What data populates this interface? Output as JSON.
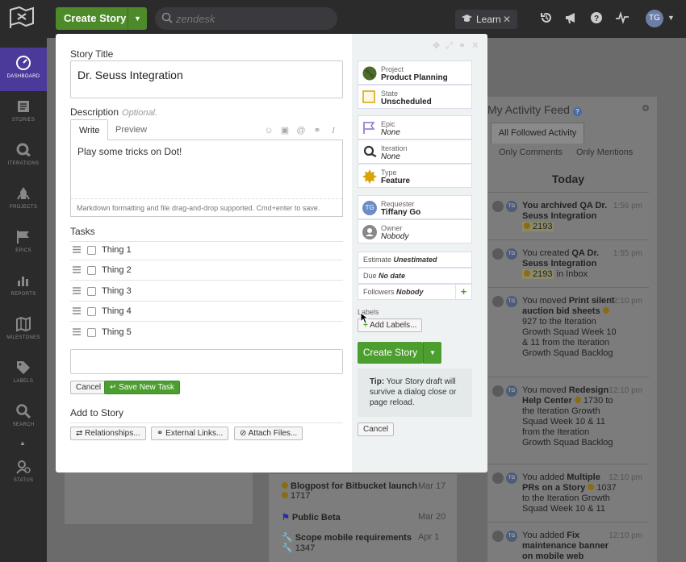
{
  "topbar": {
    "create_story": "Create Story",
    "search_placeholder": "zendesk",
    "learn": "Learn",
    "avatar": "TG"
  },
  "sidenav": [
    {
      "label": "DASHBOARD",
      "icon": "dashboard-icon",
      "active": true
    },
    {
      "label": "STORIES",
      "icon": "stories-icon"
    },
    {
      "label": "ITERATIONS",
      "icon": "iterations-icon"
    },
    {
      "label": "PROJECTS",
      "icon": "projects-icon"
    },
    {
      "label": "EPICS",
      "icon": "epics-icon"
    },
    {
      "label": "REPORTS",
      "icon": "reports-icon"
    },
    {
      "label": "MILESTONES",
      "icon": "milestones-icon"
    },
    {
      "label": "LABELS",
      "icon": "labels-icon"
    },
    {
      "label": "SEARCH",
      "icon": "search-icon"
    },
    {
      "label": "STATUS",
      "icon": "status-icon"
    }
  ],
  "feed": {
    "title": "My Activity Feed",
    "tab_all": "All Followed Activity",
    "tab_comments": "Only Comments",
    "tab_mentions": "Only Mentions",
    "today": "Today",
    "items": [
      {
        "avatar": "TG",
        "time": "1:56 pm",
        "pre": "You archived ",
        "bold": "QA Dr. Seuss Integration",
        "id": "2193",
        "post": ""
      },
      {
        "avatar": "TG",
        "time": "1:55 pm",
        "pre": "You created ",
        "bold": "QA Dr. Seuss Integration",
        "id": "2193",
        "post": " in Inbox"
      },
      {
        "avatar": "TG",
        "time": "12:10 pm",
        "pre": "You moved ",
        "bold": "Print silent auction bid sheets",
        "id": "927",
        "post": " to the Iteration Growth Squad Week 10 & 11 from the Iteration Growth Squad Backlog"
      },
      {
        "avatar": "TG",
        "time": "12:10 pm",
        "pre": "You moved ",
        "bold": "Redesign Help Center",
        "id": "1730",
        "post": " to the Iteration Growth Squad Week 10 & 11 from the Iteration Growth Squad Backlog"
      },
      {
        "avatar": "TG",
        "time": "12:10 pm",
        "pre": "You added ",
        "bold": "Multiple PRs on a Story",
        "id": "1037",
        "post": " to the Iteration Growth Squad Week 10 & 11"
      },
      {
        "avatar": "TG",
        "time": "12:10 pm",
        "pre": "You added ",
        "bold": "Fix maintenance banner on mobile web",
        "id": "",
        "post": ""
      }
    ]
  },
  "background_list": [
    {
      "title": "Blogpost for Bitbucket launch",
      "id": "1717",
      "date": "Mar 17"
    },
    {
      "title": "Public Beta",
      "id": "",
      "date": "Mar 20"
    },
    {
      "title": "Scope mobile requirements",
      "id": "1347",
      "date": "Apr 1"
    }
  ],
  "dialog": {
    "story_title_label": "Story Title",
    "story_title_value": "Dr. Seuss Integration",
    "description_label": "Description",
    "optional": "Optional.",
    "tab_write": "Write",
    "tab_preview": "Preview",
    "description_value": "Play some tricks on Dot!",
    "markdown_hint": "Markdown formatting and file drag-and-drop supported. Cmd+enter to save.",
    "tasks_label": "Tasks",
    "tasks": [
      "Thing 1",
      "Thing 2",
      "Thing 3",
      "Thing 4",
      "Thing 5"
    ],
    "cancel": "Cancel",
    "save_new_task": "Save New Task",
    "add_to_story": "Add to Story",
    "relationships": "Relationships...",
    "external_links": "External Links...",
    "attach_files": "Attach Files..."
  },
  "sidebar": {
    "project_key": "Project",
    "project_value": "Product Planning",
    "state_key": "State",
    "state_value": "Unscheduled",
    "epic_key": "Epic",
    "epic_value": "None",
    "iteration_key": "Iteration",
    "iteration_value": "None",
    "type_key": "Type",
    "type_value": "Feature",
    "requester_key": "Requester",
    "requester_value": "Tiffany Go",
    "requester_avatar": "TG",
    "owner_key": "Owner",
    "owner_value": "Nobody",
    "estimate_key": "Estimate",
    "estimate_value": "Unestimated",
    "due_key": "Due",
    "due_value": "No date",
    "followers_key": "Followers",
    "followers_value": "Nobody",
    "labels_key": "Labels",
    "add_labels": "Add Labels...",
    "create_story": "Create Story",
    "tip_bold": "Tip:",
    "tip_text": " Your Story draft will survive a dialog close or page reload.",
    "cancel": "Cancel"
  },
  "colors": {
    "brand_green": "#4c9e2f",
    "nav_active": "#4b3a99",
    "topbar": "#2b2b2b"
  }
}
